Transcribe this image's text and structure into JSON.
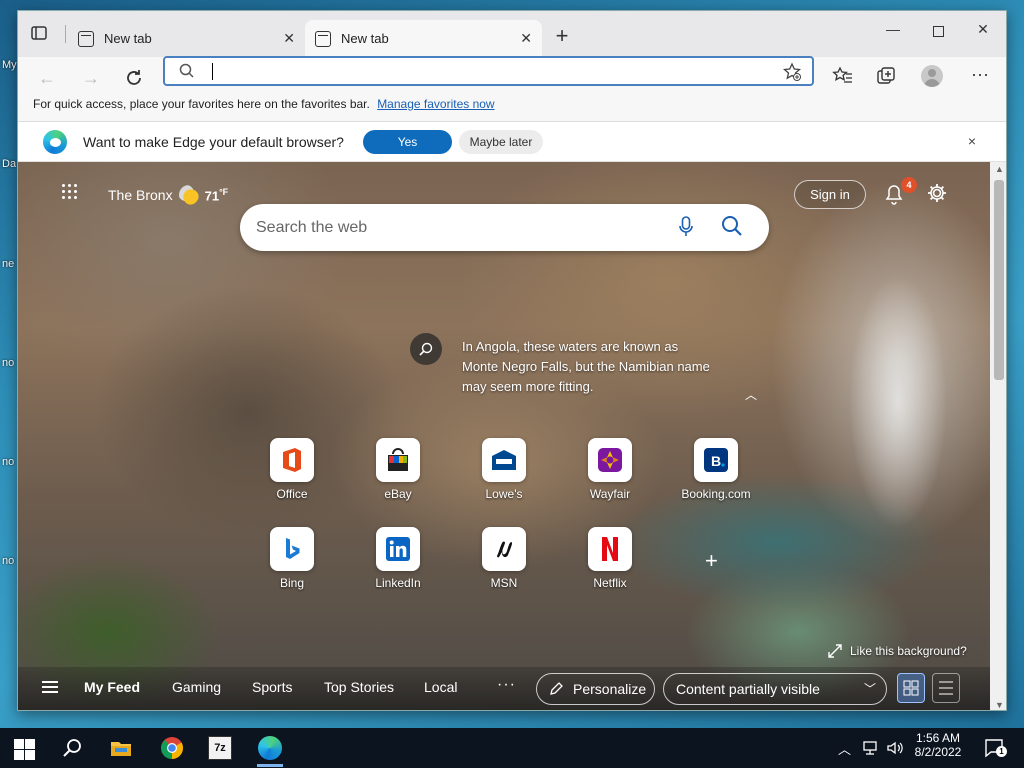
{
  "desktop": {
    "labels": [
      "My",
      "Da",
      "ne",
      "no",
      "no",
      "no"
    ]
  },
  "browser": {
    "tabs": [
      {
        "label": "New tab",
        "active": false
      },
      {
        "label": "New tab",
        "active": true
      }
    ],
    "address": {
      "value": "",
      "placeholder": ""
    },
    "favorites_bar": {
      "message": "For quick access, place your favorites here on the favorites bar.",
      "link": "Manage favorites now"
    },
    "infobar": {
      "message": "Want to make Edge your default browser?",
      "yes": "Yes",
      "later": "Maybe later",
      "close": "×"
    }
  },
  "newtab": {
    "location": "The Bronx",
    "temperature": "71",
    "temperature_unit": "°F",
    "signin": "Sign in",
    "notification_count": "4",
    "search_placeholder": "Search the web",
    "caption": "In Angola, these waters are known as Monte Negro Falls, but the Namibian name may seem more fitting.",
    "tiles": [
      {
        "label": "Office",
        "icon": "office-icon"
      },
      {
        "label": "eBay",
        "icon": "ebay-icon"
      },
      {
        "label": "Lowe's",
        "icon": "lowes-icon"
      },
      {
        "label": "Wayfair",
        "icon": "wayfair-icon"
      },
      {
        "label": "Booking.com",
        "icon": "booking-icon"
      },
      {
        "label": "Bing",
        "icon": "bing-icon"
      },
      {
        "label": "LinkedIn",
        "icon": "linkedin-icon"
      },
      {
        "label": "MSN",
        "icon": "msn-icon"
      },
      {
        "label": "Netflix",
        "icon": "netflix-icon"
      }
    ],
    "like_background": "Like this background?",
    "feed": {
      "items": [
        "My Feed",
        "Gaming",
        "Sports",
        "Top Stories",
        "Local"
      ],
      "more": "···",
      "personalize": "Personalize",
      "content_visibility": "Content partially visible"
    }
  },
  "taskbar": {
    "time": "1:56 AM",
    "date": "8/2/2022",
    "notifications": "1",
    "apps": [
      "file-explorer-icon",
      "chrome-icon",
      "7zip-icon",
      "edge-icon"
    ]
  },
  "colors": {
    "accent": "#0f6cbd",
    "badge": "#e0502a",
    "link": "#1a5fb4"
  }
}
